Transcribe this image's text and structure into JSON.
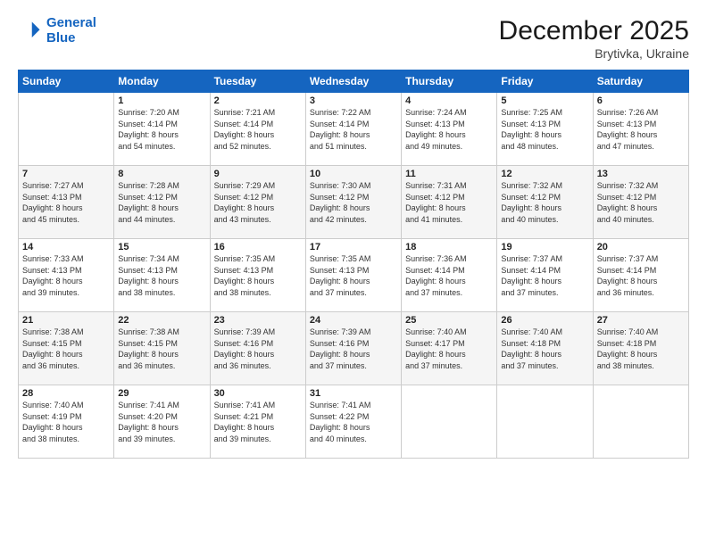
{
  "header": {
    "logo_line1": "General",
    "logo_line2": "Blue",
    "title": "December 2025",
    "subtitle": "Brytivka, Ukraine"
  },
  "days_of_week": [
    "Sunday",
    "Monday",
    "Tuesday",
    "Wednesday",
    "Thursday",
    "Friday",
    "Saturday"
  ],
  "weeks": [
    [
      {
        "num": "",
        "info": ""
      },
      {
        "num": "1",
        "info": "Sunrise: 7:20 AM\nSunset: 4:14 PM\nDaylight: 8 hours\nand 54 minutes."
      },
      {
        "num": "2",
        "info": "Sunrise: 7:21 AM\nSunset: 4:14 PM\nDaylight: 8 hours\nand 52 minutes."
      },
      {
        "num": "3",
        "info": "Sunrise: 7:22 AM\nSunset: 4:14 PM\nDaylight: 8 hours\nand 51 minutes."
      },
      {
        "num": "4",
        "info": "Sunrise: 7:24 AM\nSunset: 4:13 PM\nDaylight: 8 hours\nand 49 minutes."
      },
      {
        "num": "5",
        "info": "Sunrise: 7:25 AM\nSunset: 4:13 PM\nDaylight: 8 hours\nand 48 minutes."
      },
      {
        "num": "6",
        "info": "Sunrise: 7:26 AM\nSunset: 4:13 PM\nDaylight: 8 hours\nand 47 minutes."
      }
    ],
    [
      {
        "num": "7",
        "info": "Sunrise: 7:27 AM\nSunset: 4:13 PM\nDaylight: 8 hours\nand 45 minutes."
      },
      {
        "num": "8",
        "info": "Sunrise: 7:28 AM\nSunset: 4:12 PM\nDaylight: 8 hours\nand 44 minutes."
      },
      {
        "num": "9",
        "info": "Sunrise: 7:29 AM\nSunset: 4:12 PM\nDaylight: 8 hours\nand 43 minutes."
      },
      {
        "num": "10",
        "info": "Sunrise: 7:30 AM\nSunset: 4:12 PM\nDaylight: 8 hours\nand 42 minutes."
      },
      {
        "num": "11",
        "info": "Sunrise: 7:31 AM\nSunset: 4:12 PM\nDaylight: 8 hours\nand 41 minutes."
      },
      {
        "num": "12",
        "info": "Sunrise: 7:32 AM\nSunset: 4:12 PM\nDaylight: 8 hours\nand 40 minutes."
      },
      {
        "num": "13",
        "info": "Sunrise: 7:32 AM\nSunset: 4:12 PM\nDaylight: 8 hours\nand 40 minutes."
      }
    ],
    [
      {
        "num": "14",
        "info": "Sunrise: 7:33 AM\nSunset: 4:13 PM\nDaylight: 8 hours\nand 39 minutes."
      },
      {
        "num": "15",
        "info": "Sunrise: 7:34 AM\nSunset: 4:13 PM\nDaylight: 8 hours\nand 38 minutes."
      },
      {
        "num": "16",
        "info": "Sunrise: 7:35 AM\nSunset: 4:13 PM\nDaylight: 8 hours\nand 38 minutes."
      },
      {
        "num": "17",
        "info": "Sunrise: 7:35 AM\nSunset: 4:13 PM\nDaylight: 8 hours\nand 37 minutes."
      },
      {
        "num": "18",
        "info": "Sunrise: 7:36 AM\nSunset: 4:14 PM\nDaylight: 8 hours\nand 37 minutes."
      },
      {
        "num": "19",
        "info": "Sunrise: 7:37 AM\nSunset: 4:14 PM\nDaylight: 8 hours\nand 37 minutes."
      },
      {
        "num": "20",
        "info": "Sunrise: 7:37 AM\nSunset: 4:14 PM\nDaylight: 8 hours\nand 36 minutes."
      }
    ],
    [
      {
        "num": "21",
        "info": "Sunrise: 7:38 AM\nSunset: 4:15 PM\nDaylight: 8 hours\nand 36 minutes."
      },
      {
        "num": "22",
        "info": "Sunrise: 7:38 AM\nSunset: 4:15 PM\nDaylight: 8 hours\nand 36 minutes."
      },
      {
        "num": "23",
        "info": "Sunrise: 7:39 AM\nSunset: 4:16 PM\nDaylight: 8 hours\nand 36 minutes."
      },
      {
        "num": "24",
        "info": "Sunrise: 7:39 AM\nSunset: 4:16 PM\nDaylight: 8 hours\nand 37 minutes."
      },
      {
        "num": "25",
        "info": "Sunrise: 7:40 AM\nSunset: 4:17 PM\nDaylight: 8 hours\nand 37 minutes."
      },
      {
        "num": "26",
        "info": "Sunrise: 7:40 AM\nSunset: 4:18 PM\nDaylight: 8 hours\nand 37 minutes."
      },
      {
        "num": "27",
        "info": "Sunrise: 7:40 AM\nSunset: 4:18 PM\nDaylight: 8 hours\nand 38 minutes."
      }
    ],
    [
      {
        "num": "28",
        "info": "Sunrise: 7:40 AM\nSunset: 4:19 PM\nDaylight: 8 hours\nand 38 minutes."
      },
      {
        "num": "29",
        "info": "Sunrise: 7:41 AM\nSunset: 4:20 PM\nDaylight: 8 hours\nand 39 minutes."
      },
      {
        "num": "30",
        "info": "Sunrise: 7:41 AM\nSunset: 4:21 PM\nDaylight: 8 hours\nand 39 minutes."
      },
      {
        "num": "31",
        "info": "Sunrise: 7:41 AM\nSunset: 4:22 PM\nDaylight: 8 hours\nand 40 minutes."
      },
      {
        "num": "",
        "info": ""
      },
      {
        "num": "",
        "info": ""
      },
      {
        "num": "",
        "info": ""
      }
    ]
  ]
}
